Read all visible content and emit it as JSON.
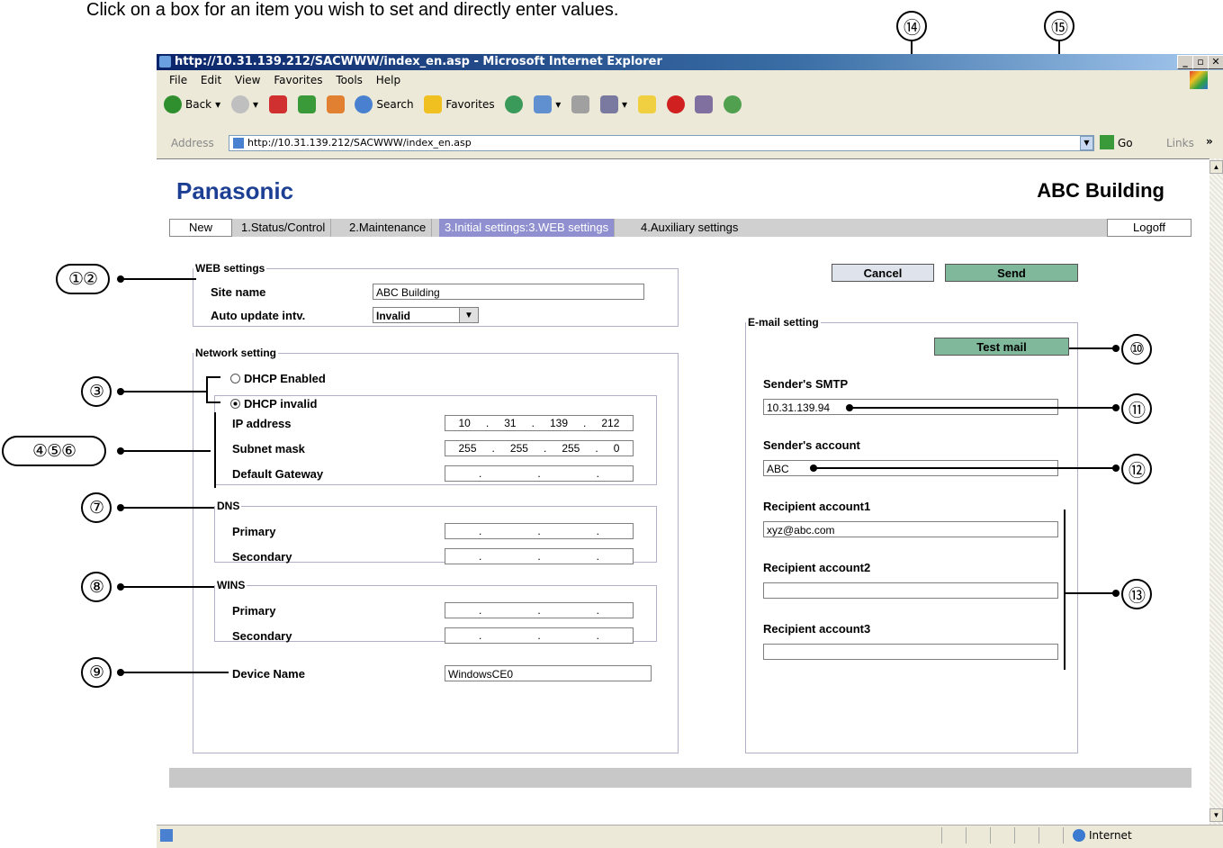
{
  "instruction": "Click on a box for an item you wish to set and directly enter values.",
  "callouts": {
    "c1_2": "①②",
    "c3": "③",
    "c4_6": "④⑤⑥",
    "c7": "⑦",
    "c8": "⑧",
    "c9": "⑨",
    "c10": "⑩",
    "c11": "⑪",
    "c12": "⑫",
    "c13": "⑬",
    "c14": "⑭",
    "c15": "⑮"
  },
  "browser": {
    "title": "http://10.31.139.212/SACWWW/index_en.asp - Microsoft Internet Explorer",
    "menu": [
      "File",
      "Edit",
      "View",
      "Favorites",
      "Tools",
      "Help"
    ],
    "toolbar": {
      "back": "Back",
      "search": "Search",
      "favorites": "Favorites"
    },
    "address_label": "Address",
    "address": "http://10.31.139.212/SACWWW/index_en.asp",
    "go": "Go",
    "links": "Links",
    "status_zone": "Internet"
  },
  "page": {
    "logo": "Panasonic",
    "site_title": "ABC Building",
    "nav": {
      "new": "New",
      "tabs": [
        "1.Status/Control",
        "2.Maintenance",
        "3.Initial settings:3.WEB settings",
        "4.Auxiliary settings"
      ],
      "logoff": "Logoff"
    },
    "cancel": "Cancel",
    "send": "Send",
    "web": {
      "legend": "WEB settings",
      "site_name_label": "Site name",
      "site_name_value": "ABC Building",
      "auto_update_label": "Auto update intv.",
      "auto_update_value": "Invalid"
    },
    "network": {
      "legend": "Network setting",
      "dhcp_enabled": "DHCP Enabled",
      "dhcp_invalid": "DHCP invalid",
      "ip_label": "IP address",
      "ip": [
        "10",
        "31",
        "139",
        "212"
      ],
      "mask_label": "Subnet mask",
      "mask": [
        "255",
        "255",
        "255",
        "0"
      ],
      "gateway_label": "Default Gateway",
      "dns_legend": "DNS",
      "wins_legend": "WINS",
      "primary": "Primary",
      "secondary": "Secondary",
      "device_label": "Device Name",
      "device_value": "WindowsCE0"
    },
    "email": {
      "legend": "E-mail setting",
      "test_mail": "Test mail",
      "smtp_label": "Sender's SMTP",
      "smtp_value": "10.31.139.94",
      "account_label": "Sender's account",
      "account_value": "ABC",
      "r1_label": "Recipient account1",
      "r1_value": "xyz@abc.com",
      "r2_label": "Recipient account2",
      "r2_value": "",
      "r3_label": "Recipient account3",
      "r3_value": ""
    }
  }
}
